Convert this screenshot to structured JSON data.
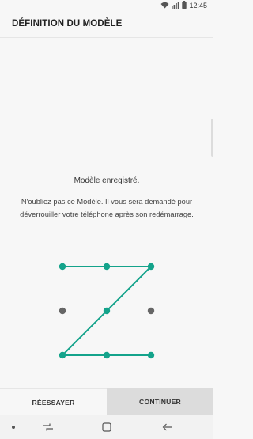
{
  "status_bar": {
    "time": "12:45",
    "icons": [
      "wifi-icon",
      "signal-icon",
      "battery-icon"
    ]
  },
  "header": {
    "title": "DÉFINITION DU MODÈLE"
  },
  "message": {
    "title": "Modèle enregistré.",
    "body": "N'oubliez pas ce Modèle. Il vous sera demandé pour déverrouiller votre téléphone après son redémarrage."
  },
  "pattern": {
    "accent_color": "#14a38b",
    "inactive_color": "#666666",
    "grid": "3x3",
    "path_dots": [
      0,
      1,
      2,
      4,
      6,
      7,
      8
    ],
    "inactive_dots": [
      3,
      5
    ]
  },
  "actions": {
    "retry_label": "RÉESSAYER",
    "continue_label": "CONTINUER"
  },
  "nav_bar": {
    "icons": [
      "dot-icon",
      "recent-apps-icon",
      "home-icon",
      "back-icon"
    ]
  }
}
